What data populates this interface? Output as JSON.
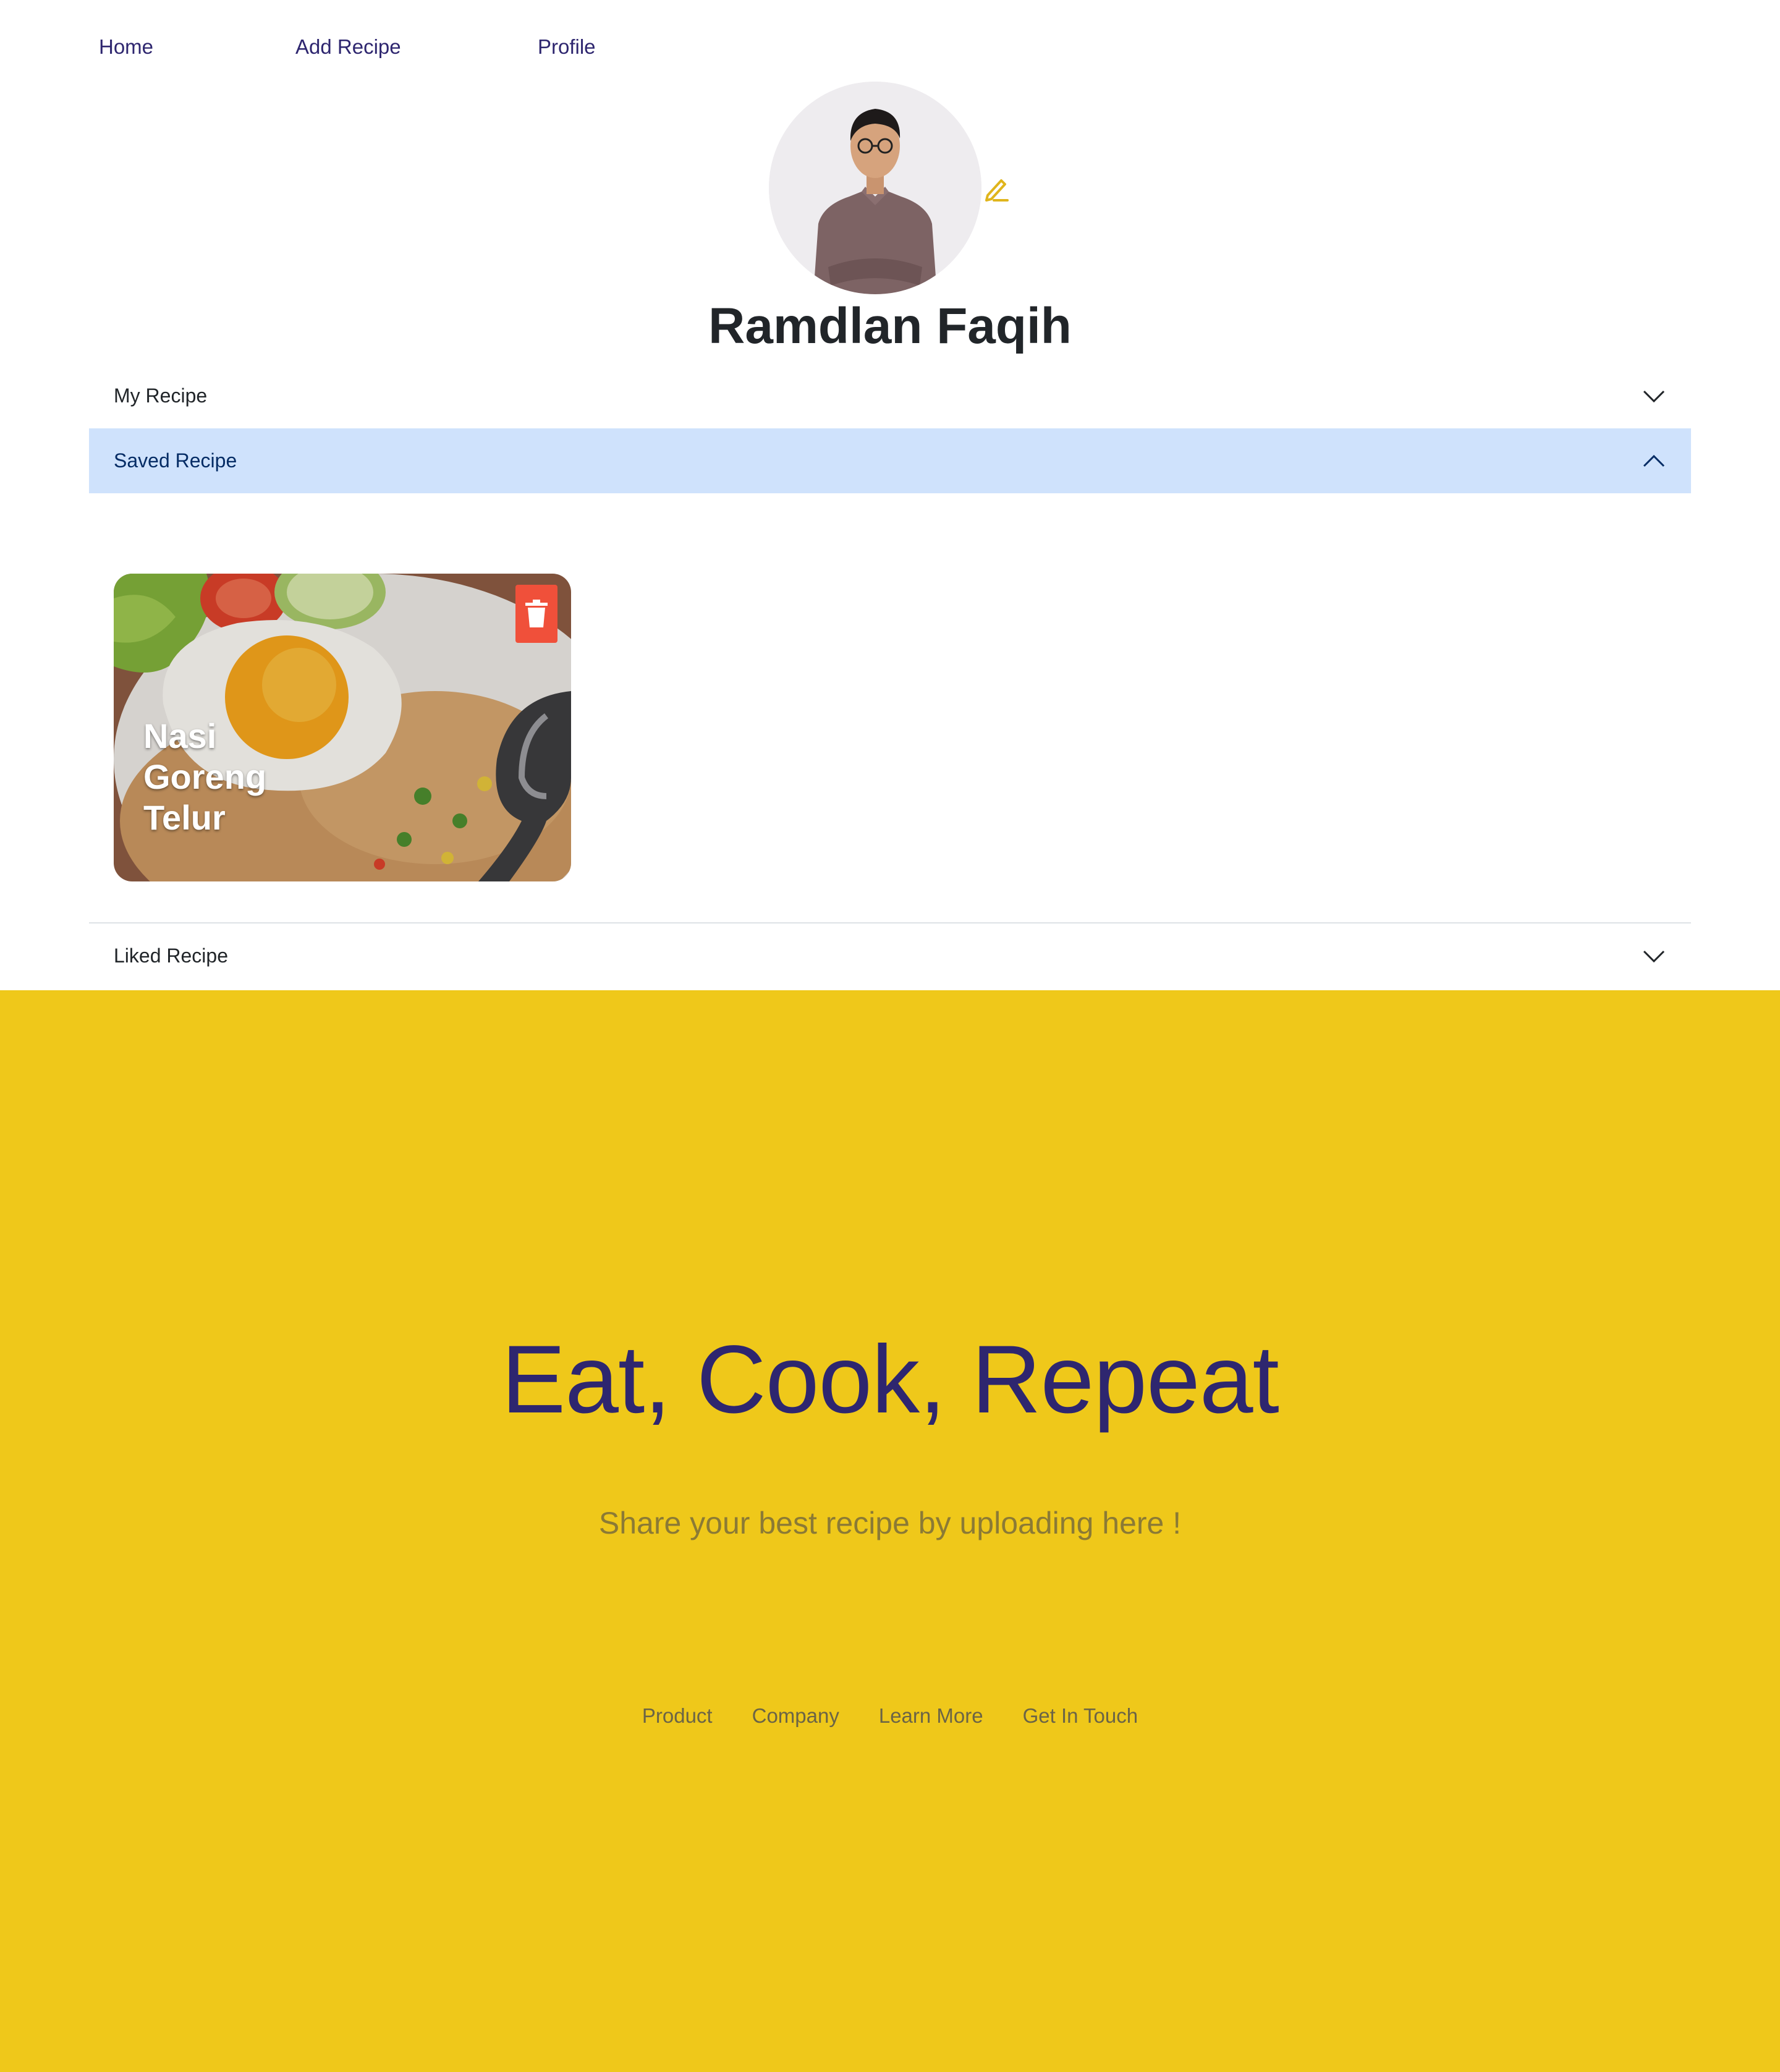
{
  "nav": {
    "home": "Home",
    "add_recipe": "Add Recipe",
    "profile": "Profile"
  },
  "profile": {
    "name": "Ramdlan Faqih"
  },
  "accordion": {
    "my_recipe": "My Recipe",
    "saved_recipe": "Saved Recipe",
    "liked_recipe": "Liked Recipe"
  },
  "saved_recipes": [
    {
      "title": "Nasi Goreng Telur"
    }
  ],
  "footer": {
    "tagline": "Eat, Cook, Repeat",
    "subtagline": "Share your best recipe by uploading here !",
    "links": [
      "Product",
      "Company",
      "Learn More",
      "Get In Touch"
    ]
  },
  "colors": {
    "accent": "#efc81a",
    "nav_text": "#2e266f",
    "active_accordion": "#cfe2fc",
    "delete": "#f0503a"
  }
}
